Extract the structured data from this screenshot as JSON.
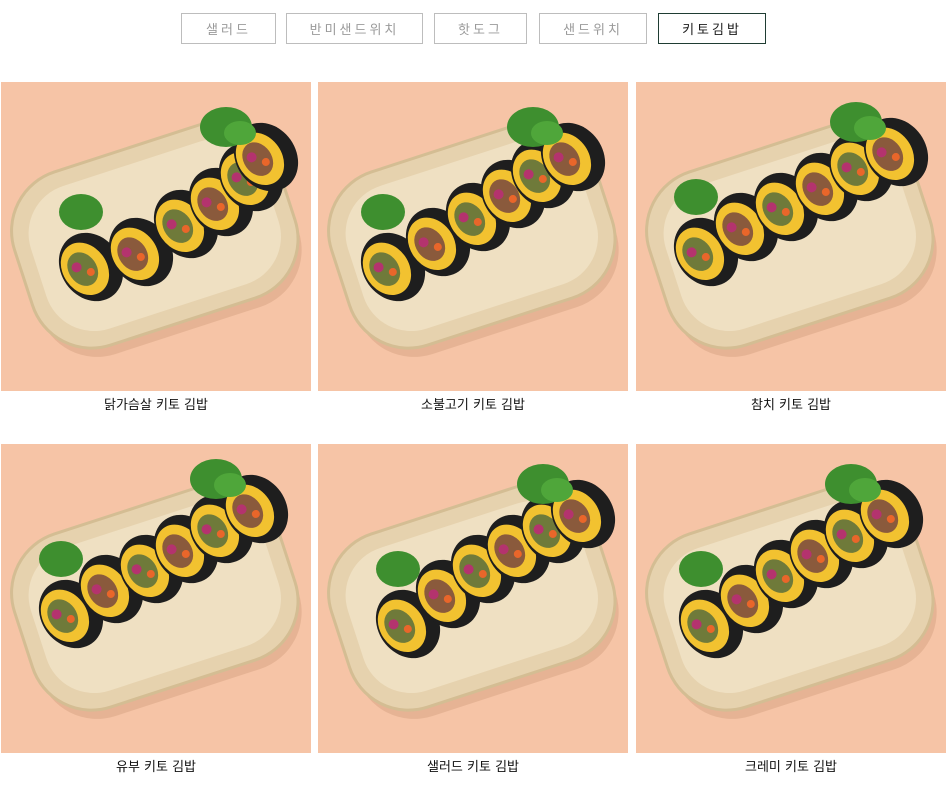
{
  "tabs": [
    {
      "label": "샐러드",
      "active": false
    },
    {
      "label": "반미샌드위치",
      "active": false
    },
    {
      "label": "핫도그",
      "active": false
    },
    {
      "label": "샌드위치",
      "active": false
    },
    {
      "label": "키토김밥",
      "active": true
    }
  ],
  "products": [
    {
      "name": "닭가슴살 키토 김밥",
      "image": "keto-gimbap-chicken-breast-photo"
    },
    {
      "name": "소불고기 키토 김밥",
      "image": "keto-gimbap-beef-bulgogi-photo"
    },
    {
      "name": "참치 키토 김밥",
      "image": "keto-gimbap-tuna-photo"
    },
    {
      "name": "유부 키토 김밥",
      "image": "keto-gimbap-fried-tofu-photo"
    },
    {
      "name": "샐러드 키토 김밥",
      "image": "keto-gimbap-salad-photo"
    },
    {
      "name": "크레미 키토 김밥",
      "image": "keto-gimbap-crab-stick-photo"
    }
  ],
  "colors": {
    "photo_background": "#f6c4a6",
    "tray": "#e6d2ae",
    "seaweed": "#1e1e1e",
    "egg": "#f2c230",
    "lettuce": "#3e8f2f",
    "active_tab_border": "#1f3d33"
  }
}
